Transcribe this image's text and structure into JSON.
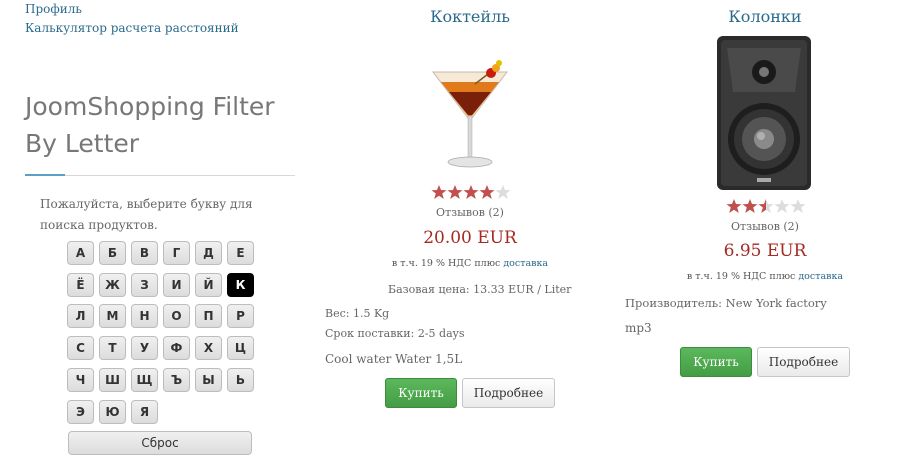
{
  "sidebar": {
    "links": [
      "Профиль",
      "Калькулятор расчета расстояний"
    ],
    "title": "JoomShopping Filter By Letter",
    "hint": "Пожалуйста, выберите букву для поиска продуктов.",
    "letters": [
      "А",
      "Б",
      "В",
      "Г",
      "Д",
      "Е",
      "Ё",
      "Ж",
      "З",
      "И",
      "Й",
      "К",
      "Л",
      "М",
      "Н",
      "О",
      "П",
      "Р",
      "С",
      "Т",
      "У",
      "Ф",
      "Х",
      "Ц",
      "Ч",
      "Ш",
      "Щ",
      "Ъ",
      "Ы",
      "Ь",
      "Э",
      "Ю",
      "Я"
    ],
    "active_letter": "К",
    "reset_label": "Сброс"
  },
  "products": [
    {
      "name": "Коктейль",
      "image": "cocktail-glass-image",
      "rating": 4,
      "reviews": "Отзывов (2)",
      "price": "20.00 EUR",
      "vat_text": "в т.ч. 19 % НДС плюс",
      "vat_link": "доставка",
      "base_price": "Базовая цена: 13.33 EUR / Liter",
      "weight": "Вес: 1.5 Kg",
      "delivery": "Срок поставки: 2-5 days",
      "extra": "Cool water Water 1,5L",
      "buy_label": "Купить",
      "more_label": "Подробнее"
    },
    {
      "name": "Колонки",
      "image": "speaker-image",
      "rating": 2.5,
      "reviews": "Отзывов (2)",
      "price": "6.95 EUR",
      "vat_text": "в т.ч. 19 % НДС плюс",
      "vat_link": "доставка",
      "manufacturer": "Производитель: New York factory",
      "extra": "mp3",
      "buy_label": "Купить",
      "more_label": "Подробнее"
    }
  ],
  "colors": {
    "link": "#2b6a8c",
    "price": "#a52a22",
    "buy": "#5cb85c",
    "star_on": "#c0504d",
    "star_off": "#dddddd"
  }
}
